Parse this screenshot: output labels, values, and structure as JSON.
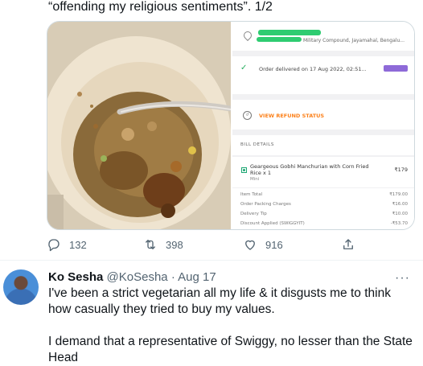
{
  "tweet1": {
    "text_tail": "“offending my religious sentiments”. 1/2",
    "receipt": {
      "address": "Military Compound, Jayamahal, Bengalu...",
      "delivered": "Order delivered on 17 Aug 2022, 02:51...",
      "refund_label": "VIEW REFUND STATUS",
      "bill_title": "BILL DETAILS",
      "item_name": "Geargeous Gobhi Manchurian with Corn Fried Rice x 1",
      "item_size": "Mini",
      "item_price": "₹179",
      "lines": [
        {
          "label": "Item Total",
          "amount": "₹179.00"
        },
        {
          "label": "Order Packing Charges",
          "amount": "₹16.00"
        },
        {
          "label": "Delivery Tip",
          "amount": "₹10.00"
        },
        {
          "label": "Discount Applied (SWIGGYIT)",
          "amount": "-₹53.70"
        }
      ]
    },
    "actions": {
      "replies": "132",
      "retweets": "398",
      "likes": "916"
    }
  },
  "tweet2": {
    "name": "Ko Sesha",
    "handle": "@KoSesha",
    "separator": "·",
    "date": "Aug 17",
    "more": "···",
    "paragraph1": "I've been a strict vegetarian all my life & it disgusts me to think how casually they tried to buy my values.",
    "paragraph2": "I demand that a representative of Swiggy, no lesser than the State Head"
  },
  "colors": {
    "swiggy_orange": "#fc8019",
    "veg_green": "#1ba672",
    "muted_text": "#536471"
  }
}
